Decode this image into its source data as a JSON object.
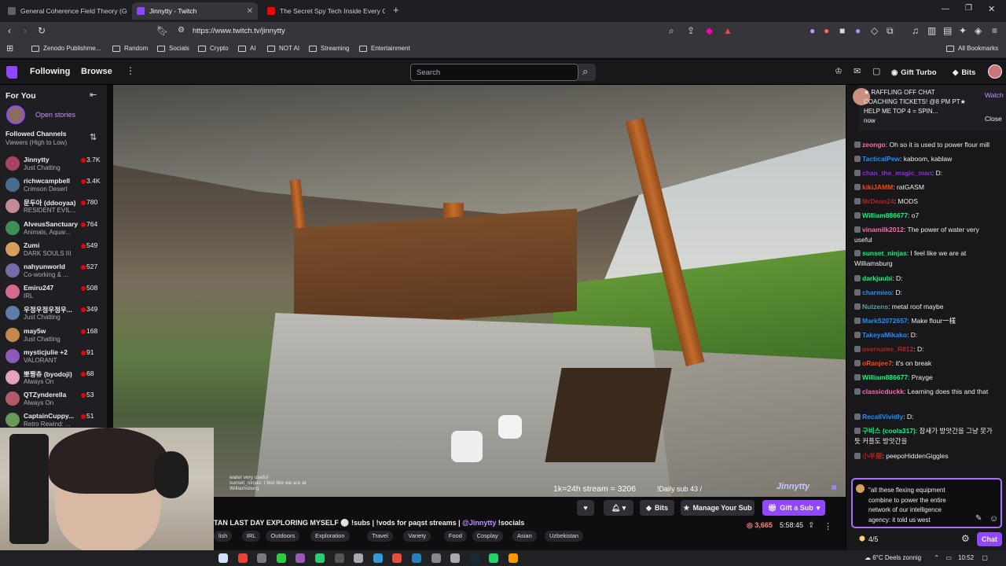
{
  "browser": {
    "tabs": [
      {
        "label": "General Coherence Field Theory (GC",
        "active": false,
        "favicon_color": "#5f6368"
      },
      {
        "label": "Jinnytty - Twitch",
        "active": true,
        "favicon_color": "#9147ff"
      },
      {
        "label": "The Secret Spy Tech Inside Every Cre",
        "active": false,
        "favicon_color": "#ff0000"
      }
    ],
    "new_tab": "+",
    "url": "https://www.twitch.tv/jinnytty",
    "bookmarks": [
      "Zenodo Publishme...",
      "Random",
      "Socials",
      "Crypto",
      "AI",
      "NOT AI",
      "Streaming",
      "Entertainment"
    ],
    "all_bookmarks": "All Bookmarks"
  },
  "twitch": {
    "nav": {
      "following": "Following",
      "browse": "Browse",
      "search_placeholder": "Search",
      "gift_turbo": "Gift Turbo",
      "bits": "Bits"
    },
    "sidebar": {
      "for_you": "For You",
      "open_stories": "Open stories",
      "followed_title": "Followed Channels",
      "followed_sort": "Viewers (High to Low)",
      "channels": [
        {
          "name": "Jinnytty",
          "category": "Just Chatting",
          "viewers": "3.7K",
          "color": "#a9445e"
        },
        {
          "name": "richwcampbell",
          "category": "Crimson Desert",
          "viewers": "3.4K",
          "color": "#4a6b8a"
        },
        {
          "name": "문두아 (ddooyaa)",
          "category": "RESIDENT EVIL...",
          "viewers": "780",
          "color": "#c78b94"
        },
        {
          "name": "AlveusSanctuary",
          "category": "Animals, Aquar...",
          "viewers": "764",
          "color": "#3c8f57"
        },
        {
          "name": "Zumi",
          "category": "DARK SOULS III",
          "viewers": "549",
          "color": "#d4a05a"
        },
        {
          "name": "nahyunworld",
          "category": "Co-working & ...",
          "viewers": "527",
          "color": "#7a6aa8"
        },
        {
          "name": "Emiru247",
          "category": "IRL",
          "viewers": "508",
          "color": "#d46a8c"
        },
        {
          "name": "우정우정우정우...",
          "category": "Just Chatting",
          "viewers": "349",
          "color": "#5e7ea8"
        },
        {
          "name": "may5w",
          "category": "Just Chatting",
          "viewers": "168",
          "color": "#c4884a"
        },
        {
          "name": "mysticjulie +2",
          "category": "VALORANT",
          "viewers": "91",
          "color": "#8c5ab8"
        },
        {
          "name": "뽀짱츄 (byodoji)",
          "category": "Always On",
          "viewers": "68",
          "color": "#e0a3b8"
        },
        {
          "name": "QTZynderella",
          "category": "Always On",
          "viewers": "53",
          "color": "#b05a6a"
        },
        {
          "name": "CaptainCuppy...",
          "category": "Retro Rewind: ...",
          "viewers": "51",
          "color": "#6a9a5a"
        }
      ]
    },
    "video": {
      "overlay_stat": "1k=24h stream = 3206",
      "overlay_sub": "!Daily sub 43 /",
      "overlay_brand": "Jinnytty",
      "overlay_chat": [
        "water very useful",
        "sunset_ninjas: I feel like we are at Williamsburg",
        "darkjuubi"
      ]
    },
    "stream": {
      "title_prefix": "TAN LAST DAY EXPLORING MYSELF ⚪ !subs | !vods for paqst streams | ",
      "title_mention": "@Jinnytty",
      "title_suffix": " !socials",
      "tags": [
        "lish",
        "IRL",
        "Outdoors",
        "Exploration",
        "Travel",
        "Variety",
        "Food",
        "Cosplay",
        "Asian",
        "Uzbekistan"
      ],
      "viewers": "3,665",
      "uptime": "5:58:45",
      "bits_btn": "Bits",
      "manage_sub_btn": "Manage Your Sub",
      "gift_sub_btn": "Gift a Sub"
    },
    "chat": {
      "pinned_text": "★ RAFFLING OFF CHAT COACHING TICKETS! @8 PM PT★ HELP ME TOP 4 = SPIN...",
      "pinned_time": "now",
      "pinned_watch": "Watch",
      "pinned_close": "Close",
      "messages": [
        {
          "user": "zeongo",
          "text": "Oh so it is used to power flour mill",
          "color": "#ff69b4"
        },
        {
          "user": "TacticalPew",
          "text": "kaboom, kablaw",
          "color": "#1e90ff"
        },
        {
          "user": "chan_the_magic_man",
          "text": "D:",
          "color": "#8a2be2"
        },
        {
          "user": "kikiJAMM",
          "text": "ratGASM",
          "color": "#ff4500"
        },
        {
          "user": "MrDean24",
          "text": "MODS",
          "color": "#b22222"
        },
        {
          "user": "William886677",
          "text": "o7",
          "color": "#00ff7f"
        },
        {
          "user": "vinamilk2012",
          "text": "The power of water very useful",
          "color": "#ff69b4"
        },
        {
          "user": "sunset_ninjas",
          "text": "I feel like we are at Williamsburg",
          "color": "#00ff7f"
        },
        {
          "user": "darkjuubi",
          "text": "D:",
          "color": "#00ff7f"
        },
        {
          "user": "charmieo",
          "text": "D:",
          "color": "#1e90ff"
        },
        {
          "user": "Nutzens",
          "text": "metal roof maybe",
          "color": "#5f9ea0"
        },
        {
          "user": "Mark52072657",
          "text": "Make flour一樣",
          "color": "#1e90ff"
        },
        {
          "user": "TakeyaMikako",
          "text": "D:",
          "color": "#1e90ff"
        },
        {
          "user": "username_R812",
          "text": "D:",
          "color": "#b22222"
        },
        {
          "user": "oRanjee7",
          "text": "it's on break",
          "color": "#ff4500"
        },
        {
          "user": "William886677",
          "text": "Prayge",
          "color": "#00ff7f"
        },
        {
          "user": "classicduckk",
          "text": "Learning does this and that",
          "color": "#ff69b4"
        },
        {
          "user": "RecallVividly",
          "text": "D:",
          "color": "#1e90ff"
        },
        {
          "user": "구비스 (coola317)",
          "text": "잠새가 방앗간을 그냥 못가듯 커플도 방앗간을",
          "color": "#00ff7f"
        },
        {
          "user": "小半屋",
          "text": "peepoHiddenGiggles",
          "color": "#b22222"
        }
      ],
      "input_text": "\"all these flexing equipment combine to power the entire network of our intelligence agency: it told us west",
      "points": "4/5",
      "send_btn": "Chat"
    }
  },
  "taskbar": {
    "weather": "6°C  Deels zonnig",
    "time": "10:52"
  }
}
